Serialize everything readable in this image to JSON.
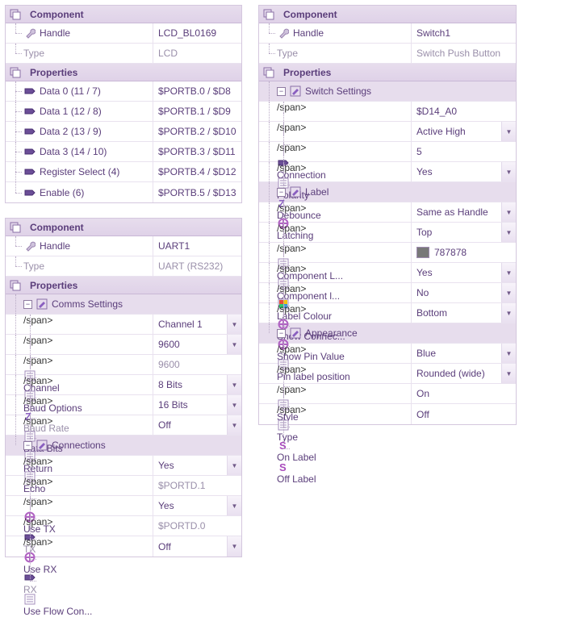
{
  "headers": {
    "component": "Component",
    "properties": "Properties",
    "handle": "Handle",
    "type": "Type"
  },
  "panel1": {
    "handle": "LCD_BL0169",
    "type": "LCD",
    "rows": [
      {
        "label": "Data 0 (11 / 7)",
        "value": "$PORTB.0 / $D8"
      },
      {
        "label": "Data 1 (12 / 8)",
        "value": "$PORTB.1 / $D9"
      },
      {
        "label": "Data 2 (13 / 9)",
        "value": "$PORTB.2 / $D10"
      },
      {
        "label": "Data 3 (14 / 10)",
        "value": "$PORTB.3 / $D11"
      },
      {
        "label": "Register Select (4)",
        "value": "$PORTB.4 / $D12"
      },
      {
        "label": "Enable (6)",
        "value": "$PORTB.5 / $D13"
      }
    ]
  },
  "panel2": {
    "handle": "UART1",
    "type": "UART (RS232)",
    "groups": [
      {
        "name": "Comms Settings",
        "rows": [
          {
            "icon": "list",
            "label": "Channel",
            "value": "Channel 1",
            "dd": true
          },
          {
            "icon": "list",
            "label": "Baud Options",
            "value": "9600",
            "dd": true
          },
          {
            "icon": "z",
            "label": "Baud Rate",
            "value": "9600",
            "dim": true
          },
          {
            "icon": "list",
            "label": "Data Bits",
            "value": "8 Bits",
            "dd": true
          },
          {
            "icon": "list",
            "label": "Return",
            "value": "16 Bits",
            "dd": true
          },
          {
            "icon": "list",
            "label": "Echo",
            "value": "Off",
            "dd": true
          }
        ]
      },
      {
        "name": "Connections",
        "rows": [
          {
            "icon": "circle",
            "label": "Use TX",
            "value": "Yes",
            "dd": true
          },
          {
            "icon": "pin",
            "label": "TX",
            "value": "$PORTD.1",
            "dim": true
          },
          {
            "icon": "circle",
            "label": "Use RX",
            "value": "Yes",
            "dd": true
          },
          {
            "icon": "pin",
            "label": "RX",
            "value": "$PORTD.0",
            "dim": true
          },
          {
            "icon": "list",
            "label": "Use Flow Con...",
            "value": "Off",
            "dd": true
          }
        ]
      }
    ]
  },
  "panel3": {
    "handle": "Switch1",
    "type": "Switch Push Button",
    "groups": [
      {
        "name": "Switch Settings",
        "rows": [
          {
            "icon": "pin",
            "label": "Connection",
            "value": "$D14_A0"
          },
          {
            "icon": "list",
            "label": "Polarity",
            "value": "Active High",
            "dd": true
          },
          {
            "icon": "z",
            "label": "Debounce",
            "value": "5"
          },
          {
            "icon": "circle",
            "label": "Latching",
            "value": "Yes",
            "dd": true
          }
        ]
      },
      {
        "name": "Label",
        "rows": [
          {
            "icon": "list",
            "label": "Component L...",
            "value": "Same as Handle",
            "dd": true
          },
          {
            "icon": "list",
            "label": "Component l...",
            "value": "Top",
            "dd": true
          },
          {
            "icon": "color",
            "label": "Label Colour",
            "value": "787878",
            "swatch": "#787878"
          },
          {
            "icon": "circle",
            "label": "Show Connec...",
            "value": "Yes",
            "dd": true
          },
          {
            "icon": "circle",
            "label": "Show Pin Value",
            "value": "No",
            "dd": true
          },
          {
            "icon": "list",
            "label": "Pin label position",
            "value": "Bottom",
            "dd": true
          }
        ]
      },
      {
        "name": "Appearance",
        "rows": [
          {
            "icon": "list",
            "label": "Style",
            "value": "Blue",
            "dd": true
          },
          {
            "icon": "list",
            "label": "Type",
            "value": "Rounded (wide)",
            "dd": true
          },
          {
            "icon": "s",
            "label": "On Label",
            "value": "On"
          },
          {
            "icon": "s",
            "label": "Off Label",
            "value": "Off"
          }
        ]
      }
    ]
  }
}
